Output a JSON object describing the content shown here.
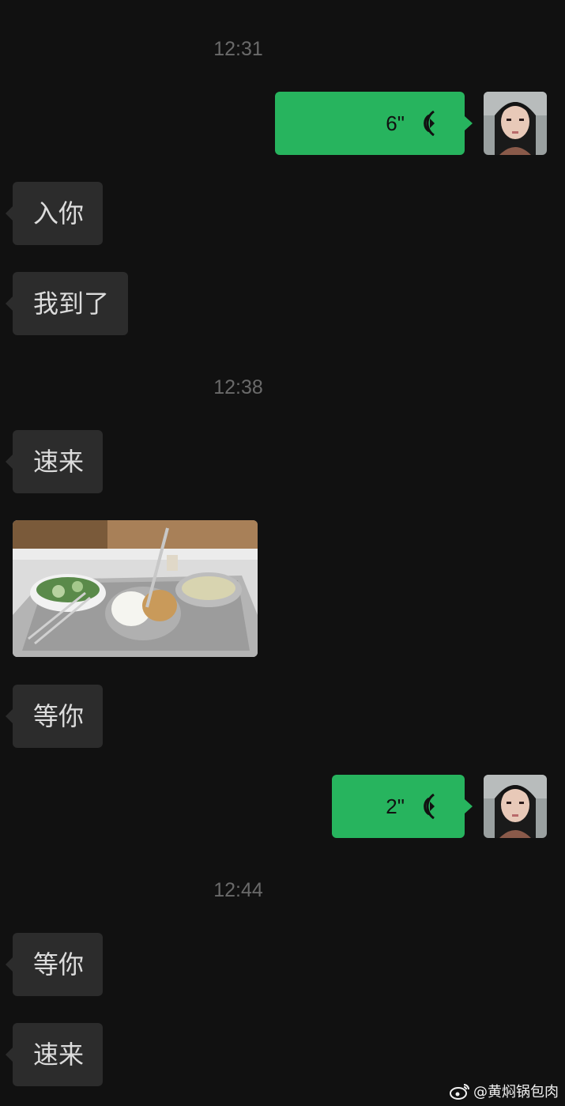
{
  "chat": {
    "timestamps": [
      "12:31",
      "12:38",
      "12:44"
    ],
    "messages": {
      "voice1_duration": "6\"",
      "in1": "入你",
      "in2": "我到了",
      "in3": "速来",
      "in4": "等你",
      "voice2_duration": "2\"",
      "in5": "等你",
      "in6": "速来"
    }
  },
  "watermark": {
    "text": "@黄焖锅包肉"
  },
  "colors": {
    "background": "#111111",
    "incoming_bubble": "#2c2c2c",
    "outgoing_bubble": "#27b45e",
    "timestamp": "#6a6a6a"
  },
  "icons": [
    "voice-wave-icon",
    "avatar",
    "weibo-logo-icon"
  ]
}
